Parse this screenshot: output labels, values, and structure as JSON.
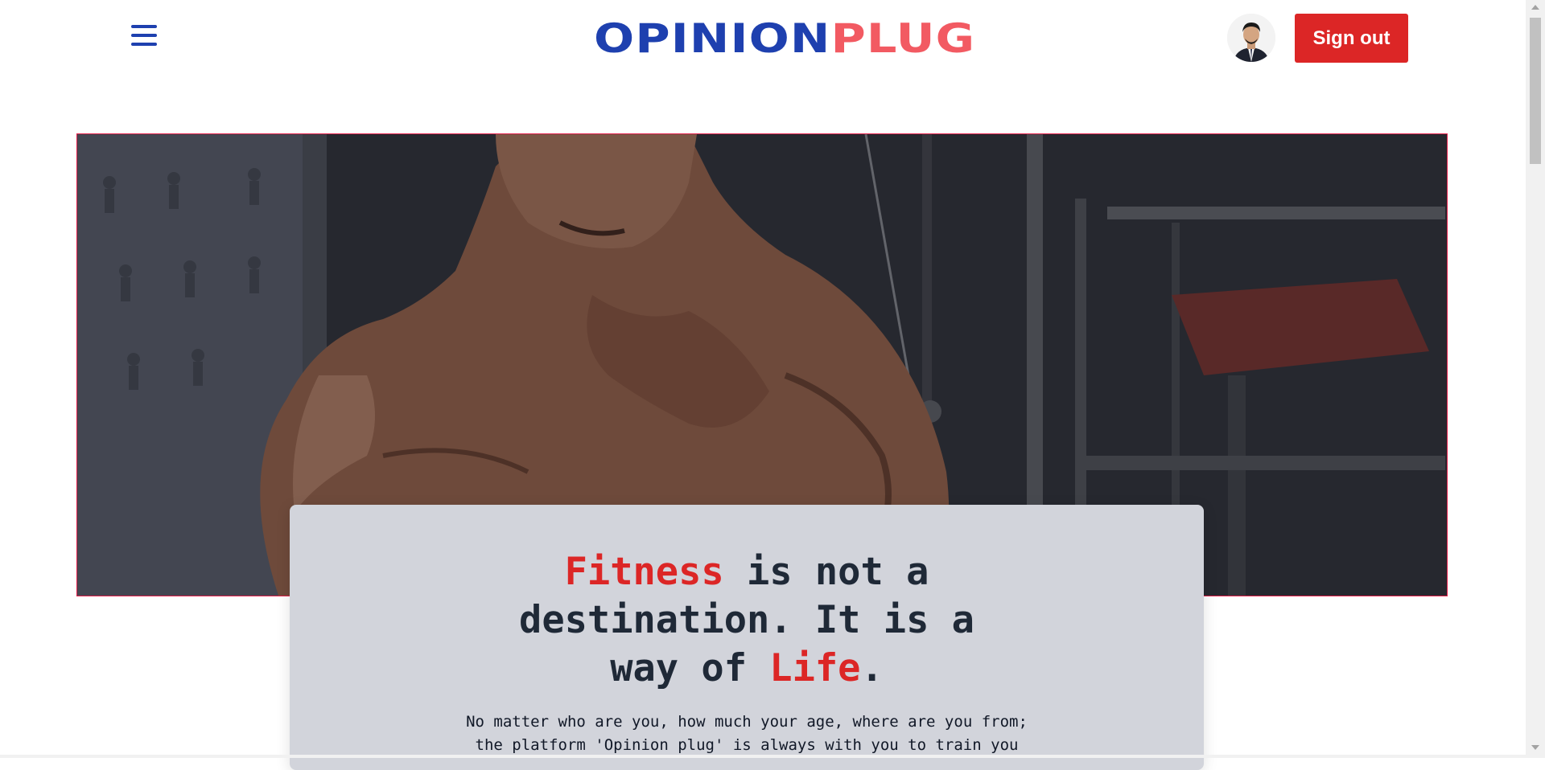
{
  "header": {
    "logo_part1": "OPINION",
    "logo_part2": "PLUG",
    "signout_label": "Sign out",
    "menu_icon": "hamburger-icon",
    "avatar_icon": "user-avatar"
  },
  "hero": {
    "image_icon": "bodybuilder-gym-photo"
  },
  "card": {
    "headline_1": "Fitness",
    "headline_2": " is not a destination. It is a way of ",
    "headline_3": "Life",
    "headline_4": ".",
    "description": "No matter who are you, how much your age, where are you from; the platform 'Opinion plug' is always with you to train you"
  },
  "colors": {
    "primary_blue": "#1e40af",
    "accent_red": "#dc2626",
    "logo_coral": "#f25a62",
    "card_bg": "#d2d4db"
  }
}
